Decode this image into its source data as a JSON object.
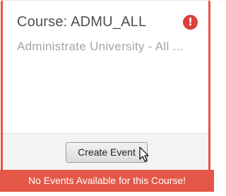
{
  "card": {
    "title": "Course: ADMU_ALL",
    "subtitle": "Administrate University - All ...",
    "alert_icon": "exclamation-icon",
    "alert_glyph": "!"
  },
  "footer": {
    "create_event_label": "Create Event"
  },
  "banner": {
    "message": "No Events Available for this Course!"
  },
  "colors": {
    "accent_red": "#e45646",
    "alert_red": "#d9413b",
    "title_text": "#4f4f4f",
    "subtitle_text": "#a4a4a4"
  }
}
